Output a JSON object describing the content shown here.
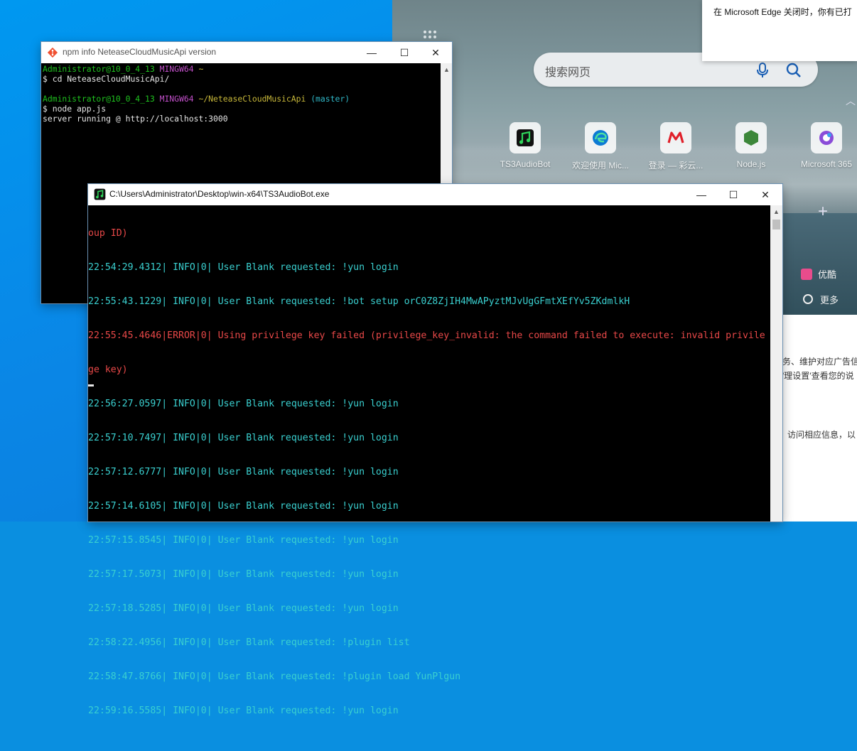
{
  "notification": {
    "text": "在 Microsoft Edge 关闭时，你有已打"
  },
  "edge": {
    "search_placeholder": "搜索网页",
    "quick_links": [
      {
        "label": "TS3AudioBot",
        "icon": "music-note-icon",
        "color": "#1db954"
      },
      {
        "label": "欢迎使用 Mic...",
        "icon": "edge-logo-icon",
        "color": "#0c7ad4"
      },
      {
        "label": "登录 — 彩云...",
        "icon": "m-logo-icon",
        "color": "#e0202a"
      },
      {
        "label": "Node.js",
        "icon": "nodejs-hexagon-icon",
        "color": "#3c873a"
      },
      {
        "label": "Microsoft 365",
        "icon": "m365-logo-icon",
        "color": "#8a4cd8"
      }
    ],
    "side_items": [
      {
        "label": "优酷",
        "icon": "youku-icon"
      },
      {
        "label": "更多",
        "icon": "more-icon"
      }
    ],
    "lower_texts": [
      "务、维护对应广告信",
      "'理设置'查看您的说",
      "访问相应信息，以"
    ]
  },
  "git_window": {
    "title": "npm info NeteaseCloudMusicApi version",
    "lines": [
      {
        "user": "Administrator@10_0_4_13",
        "sys": "MINGW64",
        "path": "~",
        "branch": ""
      },
      {
        "text": "$ cd NeteaseCloudMusicApi/"
      },
      {
        "text": ""
      },
      {
        "user": "Administrator@10_0_4_13",
        "sys": "MINGW64",
        "path": "~/NeteaseCloudMusicApi",
        "branch": "(master)"
      },
      {
        "text": "$ node app.js"
      },
      {
        "text": "server running @ http://localhost:3000"
      }
    ]
  },
  "cmd_window": {
    "title": "C:\\Users\\Administrator\\Desktop\\win-x64\\TS3AudioBot.exe",
    "lines": [
      {
        "text": "oup ID)",
        "level": "error"
      },
      {
        "text": "22:54:29.4312| INFO|0| User Blank requested: !yun login",
        "level": "info"
      },
      {
        "text": "22:55:43.1229| INFO|0| User Blank requested: !bot setup orC0Z8ZjIH4MwAPyztMJvUgGFmtXEfYv5ZKdmlkH",
        "level": "info"
      },
      {
        "text": "22:55:45.4646|ERROR|0| Using privilege key failed (privilege_key_invalid: the command failed to execute: invalid privile",
        "level": "error"
      },
      {
        "text": "ge key)",
        "level": "error"
      },
      {
        "text": "22:56:27.0597| INFO|0| User Blank requested: !yun login",
        "level": "info"
      },
      {
        "text": "22:57:10.7497| INFO|0| User Blank requested: !yun login",
        "level": "info"
      },
      {
        "text": "22:57:12.6777| INFO|0| User Blank requested: !yun login",
        "level": "info"
      },
      {
        "text": "22:57:14.6105| INFO|0| User Blank requested: !yun login",
        "level": "info"
      },
      {
        "text": "22:57:15.8545| INFO|0| User Blank requested: !yun login",
        "level": "info"
      },
      {
        "text": "22:57:17.5073| INFO|0| User Blank requested: !yun login",
        "level": "info"
      },
      {
        "text": "22:57:18.5285| INFO|0| User Blank requested: !yun login",
        "level": "info"
      },
      {
        "text": "22:58:22.4956| INFO|0| User Blank requested: !plugin list",
        "level": "info"
      },
      {
        "text": "22:58:47.8766| INFO|0| User Blank requested: !plugin load YunPlgun",
        "level": "info"
      },
      {
        "text": "22:59:16.5585| INFO|0| User Blank requested: !yun login",
        "level": "info"
      }
    ]
  },
  "window_controls": {
    "minimize": "—",
    "maximize": "☐",
    "close": "✕"
  }
}
